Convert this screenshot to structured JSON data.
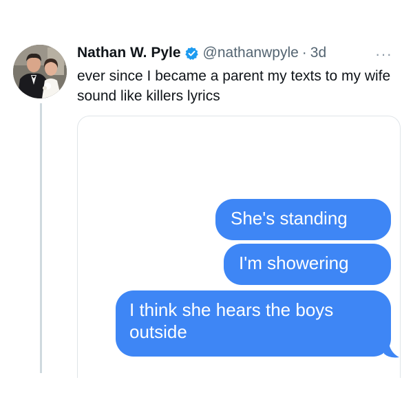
{
  "tweet": {
    "display_name": "Nathan W. Pyle",
    "handle": "@nathanwpyle",
    "separator": "·",
    "time": "3d",
    "more_glyph": "···",
    "text": "ever since I became a parent my texts to my wife sound like killers lyrics"
  },
  "media": {
    "messages": [
      {
        "text": "She's standing"
      },
      {
        "text": "I'm showering"
      },
      {
        "text": "I think she hears the boys outside"
      }
    ],
    "bubble_color": "#3e86f5"
  },
  "colors": {
    "verified_badge": "#1d9bf0",
    "thread_line": "#cfd9de"
  }
}
